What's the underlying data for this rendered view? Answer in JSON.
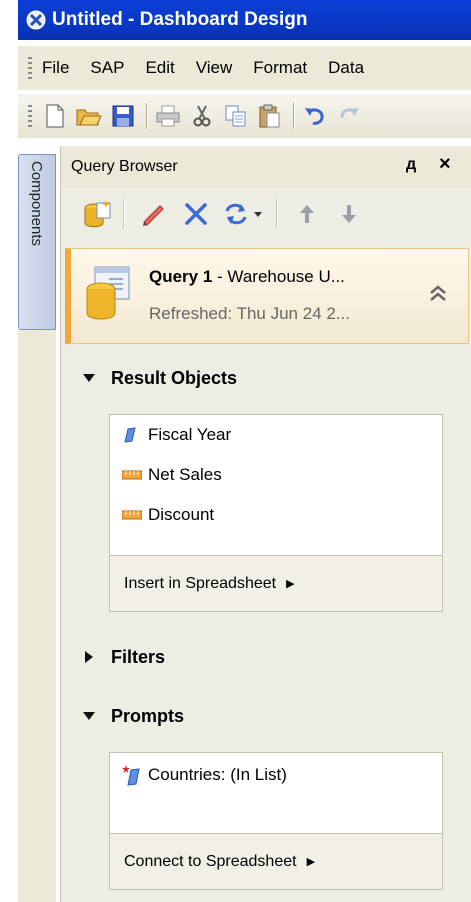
{
  "window": {
    "title": "Untitled - Dashboard Design"
  },
  "menu": {
    "items": [
      "File",
      "SAP",
      "Edit",
      "View",
      "Format",
      "Data"
    ]
  },
  "side_tab": {
    "label": "Components"
  },
  "panel": {
    "title": "Query Browser",
    "pin_glyph": "д",
    "close_glyph": "×"
  },
  "query": {
    "name": "Query 1",
    "source": " - Warehouse U...",
    "refreshed": "Refreshed: Thu Jun 24 2..."
  },
  "result_objects": {
    "heading": "Result Objects",
    "items": [
      {
        "label": "Fiscal Year",
        "icon": "dimension-icon"
      },
      {
        "label": "Net Sales",
        "icon": "measure-icon"
      },
      {
        "label": "Discount",
        "icon": "measure-icon"
      }
    ],
    "insert_label": "Insert in Spreadsheet"
  },
  "filters": {
    "heading": "Filters"
  },
  "prompts": {
    "heading": "Prompts",
    "items": [
      {
        "label": "Countries: (In List)",
        "icon": "required-prompt-icon"
      }
    ],
    "connect_label": "Connect to Spreadsheet"
  },
  "colors": {
    "titlebar": "#0a37c4",
    "query_accent": "#f0a83c",
    "panel_bg": "#eeede4"
  }
}
